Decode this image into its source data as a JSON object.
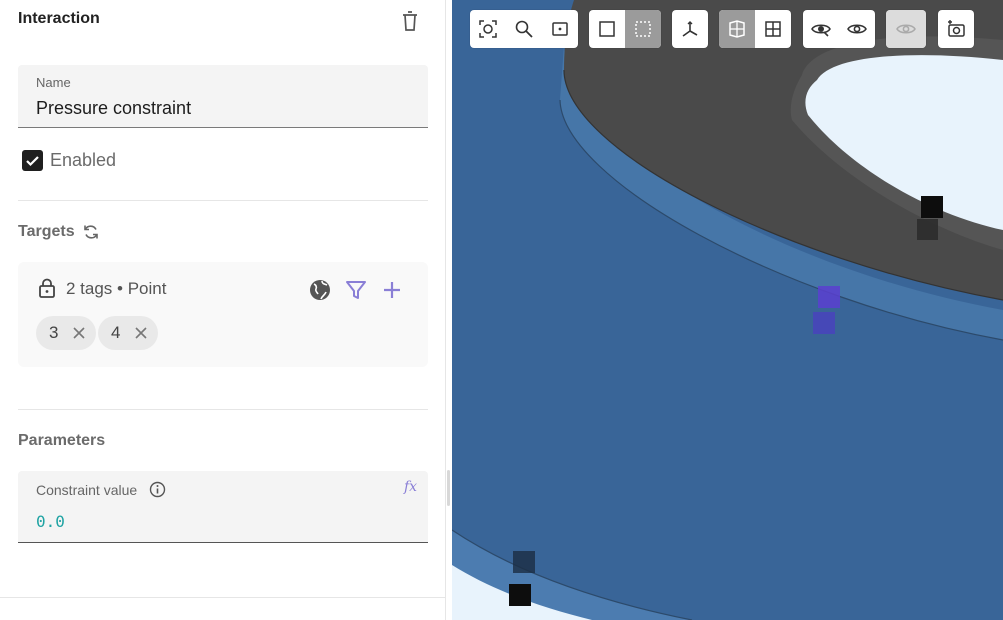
{
  "panel": {
    "title": "Interaction",
    "name_field": {
      "label": "Name",
      "value": "Pressure constraint"
    },
    "enabled": {
      "label": "Enabled",
      "checked": true
    },
    "targets": {
      "title": "Targets",
      "summary": "2 tags • Point",
      "chips": [
        "3",
        "4"
      ]
    },
    "parameters": {
      "title": "Parameters",
      "constraint": {
        "label": "Constraint value",
        "value": "0.0",
        "fx_label": "fx"
      }
    }
  },
  "toolbar": {
    "groups": [
      [
        "zoom-to-fit-icon",
        "zoom-to-selection-icon",
        "zoom-region-icon"
      ],
      [
        "select-box-icon",
        "select-dashed-box-icon"
      ],
      [
        "axes-icon"
      ],
      [
        "section-view-icon",
        "grid-view-icon"
      ],
      [
        "hide-icon",
        "show-icon"
      ],
      [
        "hidden-eye-icon"
      ],
      [
        "screenshot-icon"
      ]
    ]
  },
  "colors": {
    "viewport_background": "#396598",
    "part_top": "#4a4a4a",
    "accent": "#8a7fd6",
    "value_teal": "#1fa3a3"
  }
}
